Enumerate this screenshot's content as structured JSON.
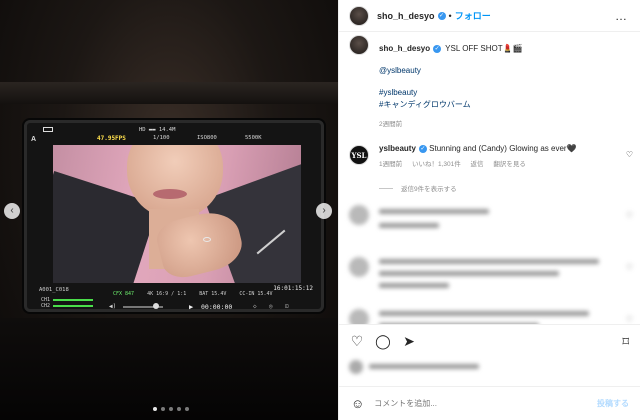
{
  "post": {
    "username": "sho_h_desyo",
    "follow_label": "フォロー",
    "separator": "•",
    "more_label": "…"
  },
  "media": {
    "monitor_osd": {
      "hd": "HD ▬▬ 14.4M",
      "fps": "47.95FPS",
      "shutter": "1/100",
      "iso": "ISO800",
      "kelvin": "5500K",
      "corner": "A",
      "clip": "A001_C018",
      "timecode": "16:01:15:12",
      "ch1": "CH1",
      "ch2": "CH2",
      "stats": [
        "CFX 847",
        "4K 16:9 / 1:1",
        "BAT 15.4V",
        "CC-IN 15.4V"
      ],
      "playback": "00:00:00",
      "play_icon": "▶"
    },
    "carousel": {
      "count": 5,
      "active_index": 0
    }
  },
  "caption": {
    "text": "YSL OFF SHOT💄🎬",
    "mention": "@yslbeauty",
    "hashtags": [
      "#yslbeauty",
      "#キャンディグロウバーム"
    ],
    "time": "2週間前"
  },
  "comment": {
    "username": "yslbeauty",
    "avatar_text": "YSL",
    "text": "Stunning and (Candy) Glowing as ever🖤",
    "time": "1週間前",
    "likes": "いいね！1,301件",
    "reply": "返信",
    "translate": "翻訳を見る",
    "view_replies": "返信9件を表示する"
  },
  "composer": {
    "placeholder": "コメントを追加...",
    "post_label": "投稿する"
  },
  "icons": {
    "heart": "♡",
    "comment": "◯",
    "share": "➤",
    "bookmark": "⌑",
    "emoji": "☺",
    "prev": "‹",
    "next": "›",
    "verified": "✓"
  }
}
